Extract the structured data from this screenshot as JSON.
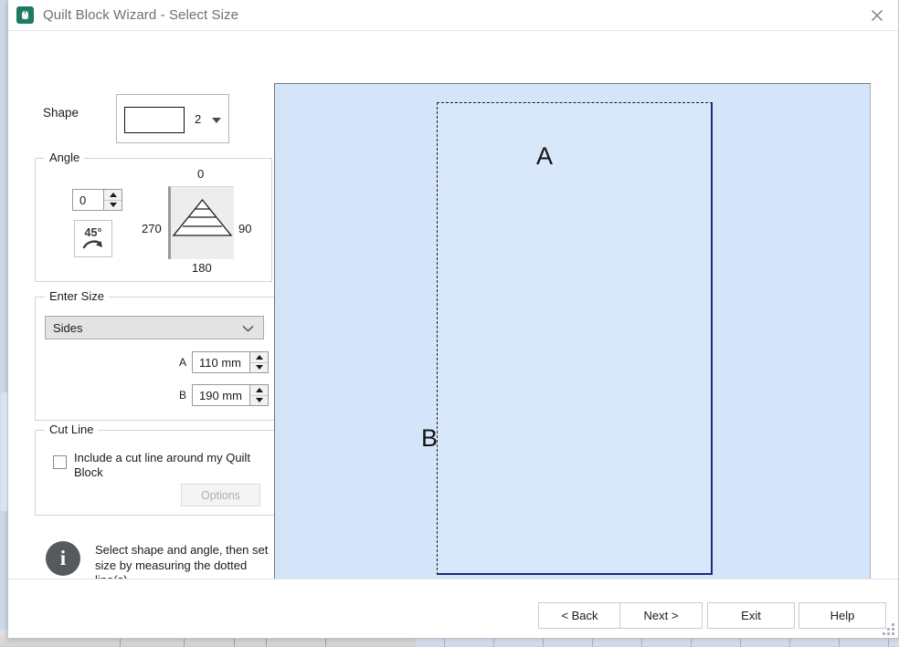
{
  "window": {
    "title": "Quilt Block Wizard - Select Size",
    "app_icon": "quilt-block-wizard-icon",
    "close_icon": "close-icon"
  },
  "shape": {
    "label": "Shape",
    "preview_icon": "rectangle-shape-preview",
    "value": "2",
    "caret_icon": "chevron-down-icon"
  },
  "angle": {
    "group_title": "Angle",
    "value": "0",
    "spin_up_icon": "spinner-up-icon",
    "spin_down_icon": "spinner-down-icon",
    "rotate_button_label": "45°",
    "rotate_button_icon": "rotate-clockwise-icon",
    "dial_icon": "angle-dial-pyramid",
    "dial_top": "0",
    "dial_right": "90",
    "dial_bottom": "180",
    "dial_left": "270"
  },
  "enter_size": {
    "group_title": "Enter Size",
    "mode": "Sides",
    "mode_options": [
      "Sides"
    ],
    "caret_icon": "chevron-down-icon",
    "fields": [
      {
        "label": "A",
        "value": "110 mm"
      },
      {
        "label": "B",
        "value": "190 mm"
      }
    ]
  },
  "cut_line": {
    "group_title": "Cut Line",
    "checkbox_label": "Include a cut line around my Quilt Block",
    "checked": false,
    "options_label": "Options",
    "options_enabled": false
  },
  "info": {
    "icon": "info-icon",
    "text": "Select shape and angle, then set size by measuring the dotted line(s)."
  },
  "preview": {
    "canvas_color": "#d4e5fa",
    "solid_edge_color": "#1b2a7a",
    "dashed_edge_color": "#1d1d1d",
    "dimension_a": "A",
    "dimension_b": "B"
  },
  "footer": {
    "back_label": "< Back",
    "next_label": "Next >",
    "exit_label": "Exit",
    "help_label": "Help",
    "resize_grip_icon": "resize-grip-icon"
  }
}
